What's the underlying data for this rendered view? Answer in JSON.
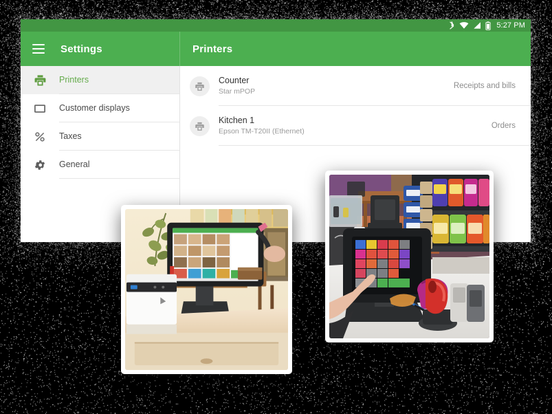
{
  "status_bar": {
    "time": "5:27 PM",
    "icons": [
      "bluetooth-icon",
      "wifi-icon",
      "cell-signal-icon",
      "battery-icon"
    ]
  },
  "toolbar": {
    "menu_icon": "hamburger-menu-icon",
    "drawer_title": "Settings",
    "page_title": "Printers"
  },
  "sidebar": {
    "items": [
      {
        "label": "Printers",
        "icon": "printer-icon",
        "active": true
      },
      {
        "label": "Customer displays",
        "icon": "display-icon",
        "active": false
      },
      {
        "label": "Taxes",
        "icon": "percent-icon",
        "active": false
      },
      {
        "label": "General",
        "icon": "gear-icon",
        "active": false
      }
    ]
  },
  "content": {
    "printers": [
      {
        "name": "Counter",
        "model": "Star mPOP",
        "role": "Receipts and bills",
        "icon": "printer-icon"
      },
      {
        "name": "Kitchen 1",
        "model": "Epson TM-T20II (Ethernet)",
        "role": "Orders",
        "icon": "printer-icon"
      }
    ]
  },
  "photos": [
    {
      "name": "pos-counter-photo",
      "alt": "Tablet POS on stand with white receipt printer on a cash drawer counter"
    },
    {
      "name": "pos-convenience-store-photo",
      "alt": "Hand tapping a tablet POS with colorful tile buttons next to a red barcode scanner in a convenience store"
    }
  ],
  "colors": {
    "toolbar_green": "#4caf50",
    "status_bar_green": "#429643",
    "active_item_green": "#64ab4b",
    "backdrop": "#000000"
  }
}
